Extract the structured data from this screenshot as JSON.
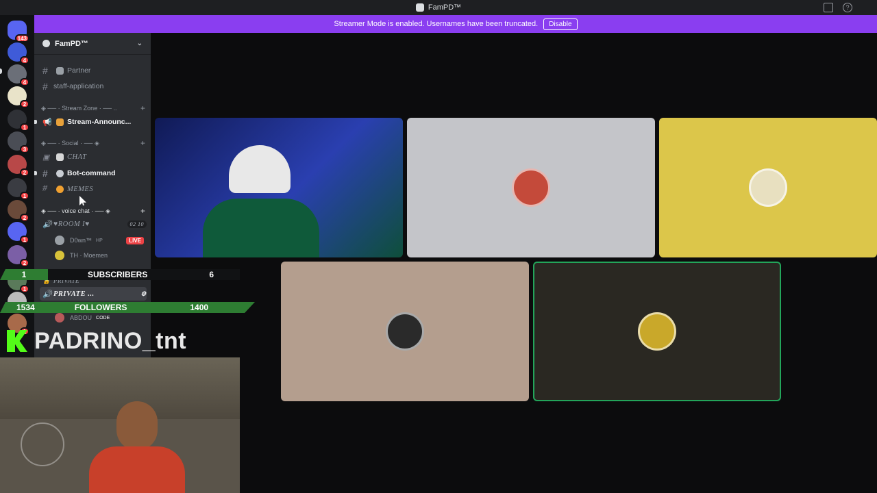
{
  "window": {
    "title": "FamPD™"
  },
  "banner": {
    "text": "Streamer Mode is enabled. Usernames have been truncated.",
    "disable_label": "Disable"
  },
  "guilds": [
    {
      "color": "#5865f2",
      "badge": "143"
    },
    {
      "color": "#3f5bd8",
      "badge": "4"
    },
    {
      "color": "#6b6f78",
      "badge": "4"
    },
    {
      "color": "#e9e3c9",
      "badge": "2"
    },
    {
      "color": "#2f3136",
      "badge": "1"
    },
    {
      "color": "#4a4d55",
      "badge": "3"
    },
    {
      "color": "#b84848",
      "badge": "2"
    },
    {
      "color": "#3a3c42",
      "badge": "1"
    },
    {
      "color": "#6a4a3a",
      "badge": "2"
    },
    {
      "color": "#5865f2",
      "badge": "1"
    },
    {
      "color": "#7b5fa6",
      "badge": "2"
    },
    {
      "color": "#5a7a5a",
      "badge": "1"
    },
    {
      "color": "#bbbbbb",
      "badge": "1"
    },
    {
      "color": "#a86a4a",
      "badge": "1"
    }
  ],
  "server": {
    "name": "FamPD™"
  },
  "channels": {
    "partner": "Partner",
    "staff_application": "staff-application",
    "cat_stream": "◈ ── · Stream Zone · ── ..",
    "stream_announcements": "Stream-Announc...",
    "cat_social": "◈ ── · Social · ── ◈",
    "chat": "CHAT",
    "bot_command": "Bot-command",
    "memes": "MEMES",
    "cat_voice": "◈ ── · voice chat · ── ◈",
    "room": "♥ROOM I♥",
    "room_counts": "02 10",
    "private_cat": "PRIVATE",
    "private_room": "PRIVATE ..."
  },
  "voice_users": [
    {
      "name": "D0wn™",
      "tag": "HP",
      "live": "LIVE"
    },
    {
      "name": "TH · Moemen",
      "tag": "",
      "live": ""
    }
  ],
  "private_users": [
    {
      "name": "ABDOU",
      "tag": "CODE"
    }
  ],
  "overlay": {
    "subs_count": "1",
    "subs_label": "SUBSCRIBERS",
    "subs_goal": "6",
    "followers_count": "1534",
    "followers_label": "FOLLOWERS",
    "followers_goal": "1400",
    "handle": "PADRINO_tnt"
  },
  "tiles": [
    {
      "bg": "#1d2a6a",
      "type": "video"
    },
    {
      "bg": "#c4c5c9",
      "avatar": "#c44a3a"
    },
    {
      "bg": "#dcc64a",
      "avatar": "#e8e0c0"
    },
    {
      "bg": "#b49e8e",
      "avatar": "#2a2a2a"
    },
    {
      "bg": "#2a2822",
      "avatar": "#c9a82a"
    }
  ]
}
